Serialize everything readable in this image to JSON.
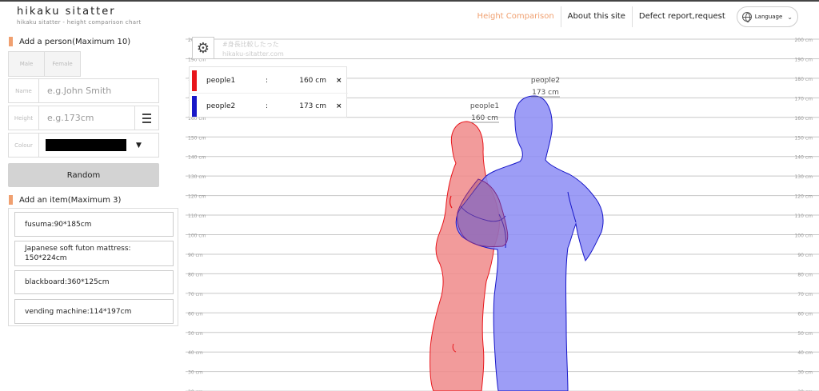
{
  "header": {
    "logo": "hikaku sitatter",
    "subtitle": "hikaku sitatter - height comparison chart",
    "nav": [
      "Height Comparison",
      "About this site",
      "Defect report,request"
    ],
    "language": "Language"
  },
  "panel": {
    "add_person_title": "Add a person(Maximum 10)",
    "gender": [
      "Male",
      "Female"
    ],
    "name_label": "Name",
    "name_placeholder": "e.g.John Smith",
    "height_label": "Height",
    "height_placeholder": "e.g.173cm",
    "colour_label": "Colour",
    "colour_value": "#000000",
    "random_label": "Random",
    "add_item_title": "Add an item(Maximum 3)",
    "items": [
      "fusuma:90*185cm",
      "Japanese soft futon mattress: 150*224cm",
      "blackboard:360*125cm",
      "vending machine:114*197cm"
    ]
  },
  "chart": {
    "watermark_line1": "#身長比較したった",
    "watermark_line2": "hikaku-sitatter.com",
    "settings_icon": "gear-icon",
    "ticks": [
      "200 cm",
      "190 cm",
      "180 cm",
      "170 cm",
      "160 cm",
      "150 cm",
      "140 cm",
      "130 cm",
      "120 cm",
      "110 cm",
      "100 cm",
      "90 cm",
      "80 cm",
      "70 cm",
      "60 cm",
      "50 cm",
      "40 cm",
      "30 cm",
      "20 cm"
    ],
    "people": [
      {
        "name": "people1",
        "height": "160 cm",
        "label_height": "160 cm",
        "color": "#e8151b",
        "fill": "#f08a8a"
      },
      {
        "name": "people2",
        "height": "173 cm",
        "label_height": "173 cm",
        "color": "#1717c8",
        "fill": "#8c8cf4"
      }
    ],
    "legend_separator": ":",
    "remove_symbol": "×"
  },
  "colors": {
    "accent": "#f0a070",
    "people1": "#e8151b",
    "people2": "#1717c8"
  }
}
